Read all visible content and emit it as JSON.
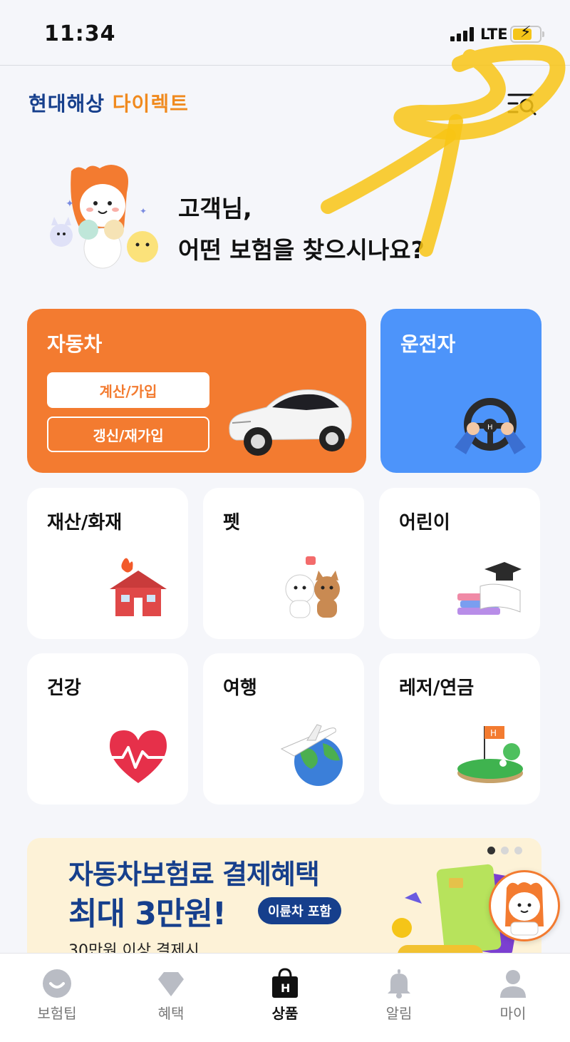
{
  "status_bar": {
    "time": "11:34",
    "network": "LTE"
  },
  "header": {
    "logo_part1": "현대해상",
    "logo_part2": "다이렉트",
    "menu_icon": "menu-search-icon"
  },
  "greeting": {
    "line1": "고객님,",
    "line2": "어떤 보험을 찾으시나요?"
  },
  "products": {
    "car": {
      "title": "자동차",
      "calc_label": "계산/가입",
      "renew_label": "갱신/재가입"
    },
    "driver": {
      "title": "운전자"
    },
    "property": {
      "title": "재산/화재"
    },
    "pet": {
      "title": "펫"
    },
    "child": {
      "title": "어린이"
    },
    "health": {
      "title": "건강"
    },
    "travel": {
      "title": "여행"
    },
    "leisure": {
      "title": "레저/연금"
    }
  },
  "banner": {
    "line1": "자동차보험료 결제혜택",
    "line2": "최대 3만원!",
    "pill": "이륜차 포함",
    "line3": "30만원 이상 결제시",
    "page_count": 3,
    "active_page": 1
  },
  "nav": [
    {
      "label": "보험팁",
      "icon": "smile-icon"
    },
    {
      "label": "혜택",
      "icon": "diamond-icon"
    },
    {
      "label": "상품",
      "icon": "shopping-bag-icon"
    },
    {
      "label": "알림",
      "icon": "bell-icon"
    },
    {
      "label": "마이",
      "icon": "person-icon"
    }
  ],
  "colors": {
    "brand_blue": "#163f8c",
    "brand_orange": "#f37b30",
    "driver_blue": "#4d94fa"
  }
}
